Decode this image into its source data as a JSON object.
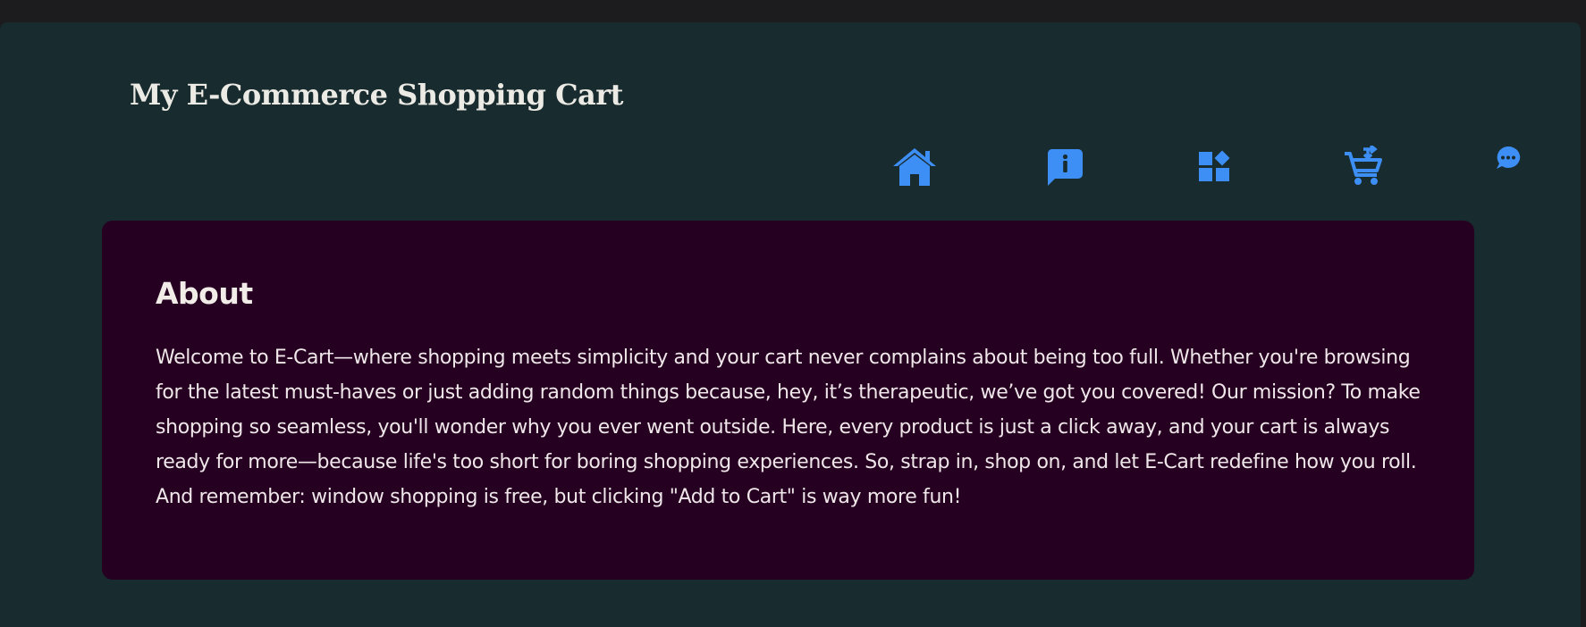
{
  "header": {
    "title": "My E-Commerce Shopping Cart"
  },
  "nav": {
    "items": [
      {
        "name": "home",
        "icon": "home-icon"
      },
      {
        "name": "about",
        "icon": "info-chat-icon"
      },
      {
        "name": "products",
        "icon": "widgets-icon"
      },
      {
        "name": "cart",
        "icon": "add-to-cart-icon"
      },
      {
        "name": "chat",
        "icon": "chat-bubble-icon"
      }
    ],
    "icon_color": "#3d8ff5"
  },
  "about": {
    "heading": "About",
    "body": "Welcome to E-Cart—where shopping meets simplicity and your cart never complains about being too full. Whether you're browsing for the latest must-haves or just adding random things because, hey, it’s therapeutic, we’ve got you covered! Our mission? To make shopping so seamless, you'll wonder why you ever went outside. Here, every product is just a click away, and your cart is always ready for more—because life's too short for boring shopping experiences. So, strap in, shop on, and let E-Cart redefine how you roll. And remember: window shopping is free, but clicking \"Add to Cart\" is way more fun!"
  },
  "colors": {
    "background": "#182c2f",
    "card": "#250020",
    "text": "#efe7e9",
    "accent": "#3d8ff5"
  }
}
